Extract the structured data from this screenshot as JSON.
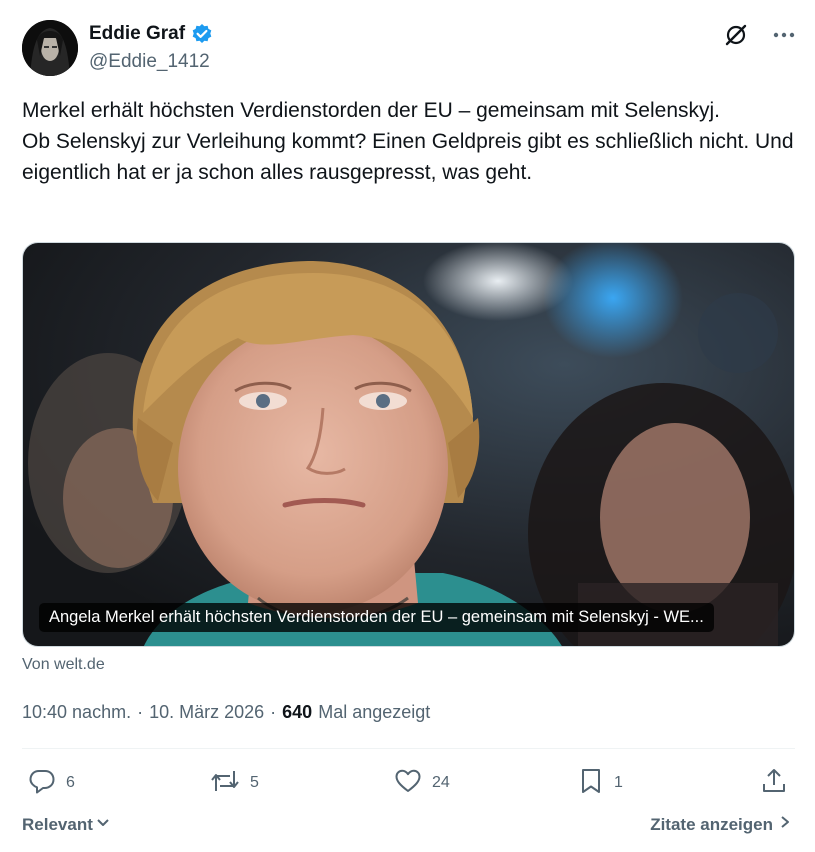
{
  "author": {
    "display_name": "Eddie Graf",
    "handle": "@Eddie_1412",
    "verified_icon": "verified-badge-icon",
    "verified_color": "#1d9bf0"
  },
  "tweet": {
    "line1": "Merkel erhält höchsten Verdienstorden der EU – gemeinsam mit Selenskyj.",
    "line2": "Ob Selenskyj zur Verleihung kommt? Einen Geldpreis gibt es schließlich nicht. Und eigentlich hat er ja schon alles rausgepresst, was geht."
  },
  "card": {
    "caption": "Angela Merkel erhält höchsten Verdienstorden der EU – gemeinsam mit Selenskyj - WE...",
    "source": "Von welt.de"
  },
  "meta": {
    "time": "10:40 nachm.",
    "sep1": "·",
    "date": "10. März 2026",
    "sep2": "·",
    "views": "640",
    "views_label": "Mal angezeigt"
  },
  "actions": {
    "replies": "6",
    "reposts": "5",
    "likes": "24",
    "bookmarks": "1"
  },
  "footer": {
    "sort_label": "Relevant",
    "quotes_label": "Zitate anzeigen"
  },
  "colors": {
    "text": "#0f1419",
    "secondary": "#536471",
    "verified": "#1d9bf0"
  }
}
